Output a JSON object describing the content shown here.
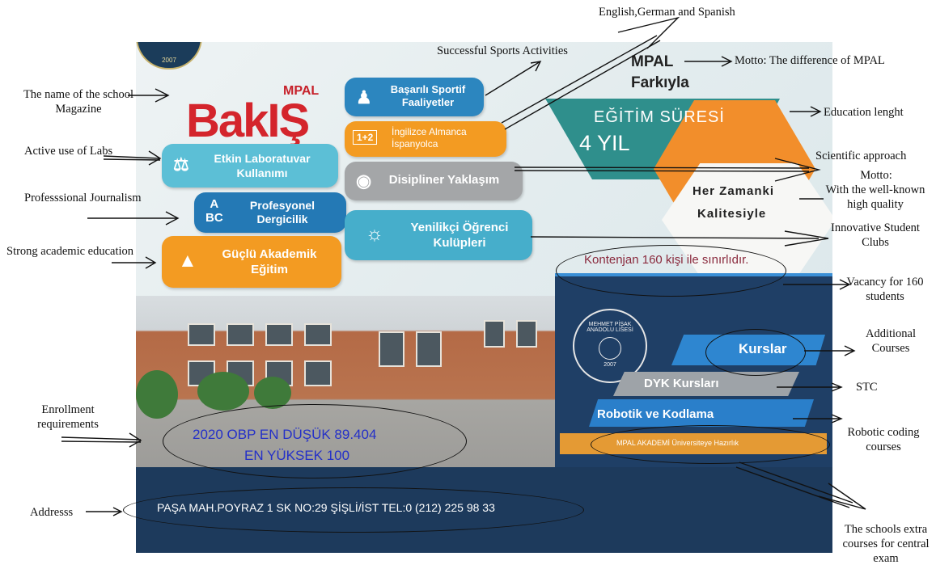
{
  "poster": {
    "magazine_word": "BakIŞ",
    "magazine_brand": "MPAL",
    "sports": "Başarılı Sportif Faaliyetler",
    "languages": "İngilizce Almanca İspanyolca",
    "lab": "Etkin Laboratuvar Kullanımı",
    "interdisciplinary": "Disipliner Yaklaşım",
    "journalism": "Profesyonel Dergicilik",
    "clubs": "Yenilikçi Öğrenci Kulüpleri",
    "academic": "Güçlü Akademik Eğitim",
    "motto_line1": "MPAL",
    "motto_line2": "Farkıyla",
    "edu_label": "EĞİTİM SÜRESİ",
    "edu_years": "4 YIL",
    "quality_line1": "Her Zamanki",
    "quality_line2": "Kalitesiyle",
    "quota": "Kontenjan 160 kişi ile sınırlıdır.",
    "obp_line1": "2020 OBP  EN DÜŞÜK 89.404",
    "obp_line2": "EN YÜKSEK 100",
    "courses": "Kurslar",
    "dyk": "DYK Kursları",
    "robotics": "Robotik ve Kodlama",
    "akademi": "MPAL AKADEMİ Üniversiteye Hazırlık",
    "address": "PAŞA MAH.POYRAZ 1 SK NO:29 ŞİŞLİ/İST TEL:0 (212) 225 98 33",
    "seal_text": "MEHMET PİŞAK ANADOLU LİSESİ",
    "seal_year": "2007"
  },
  "annotations": {
    "magazine": "The name of the school Magazine",
    "labs": "Active use of Labs",
    "journalism": "Professsional Journalism",
    "academic": "Strong academic education",
    "enrollment": "Enrollment requirements",
    "address": "Addresss",
    "sports": "Successful Sports Activities",
    "languages": "English,German and Spanish",
    "motto": "Motto: The difference of MPAL",
    "education": "Education lenght",
    "scientific": "Scientific approach",
    "motto2_a": "Motto:",
    "motto2_b": "With the well-known high quality",
    "clubs": "Innovative Student Clubs",
    "vacancy": "Vacancy for 160 students",
    "additional": "Additional Courses",
    "stc": "STC",
    "robotic": "Robotic coding courses",
    "extra": "The schools extra courses for central exam"
  },
  "colors": {
    "orange": "#f39b22",
    "blue": "#2c86bf",
    "teal": "#2f8f8c",
    "navy": "#1d3a5c",
    "red": "#d4252c"
  }
}
